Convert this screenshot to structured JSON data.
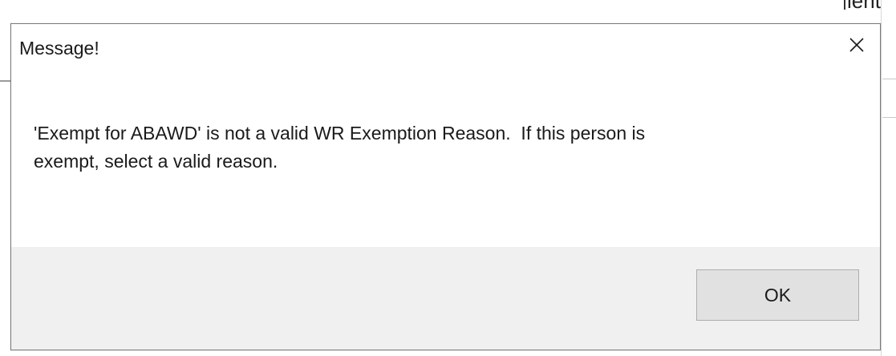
{
  "background": {
    "text_fragment": "lent"
  },
  "dialog": {
    "title": "Message!",
    "close_icon": "close-icon",
    "message": "'Exempt for ABAWD' is not a valid WR Exemption Reason.  If this person is\nexempt, select a valid reason.",
    "ok_label": "OK"
  },
  "colors": {
    "dialog_background": "#ffffff",
    "footer_background": "#f0f0f0",
    "button_background": "#e1e1e1",
    "button_border": "#adadad",
    "border": "#7a7a7a"
  }
}
